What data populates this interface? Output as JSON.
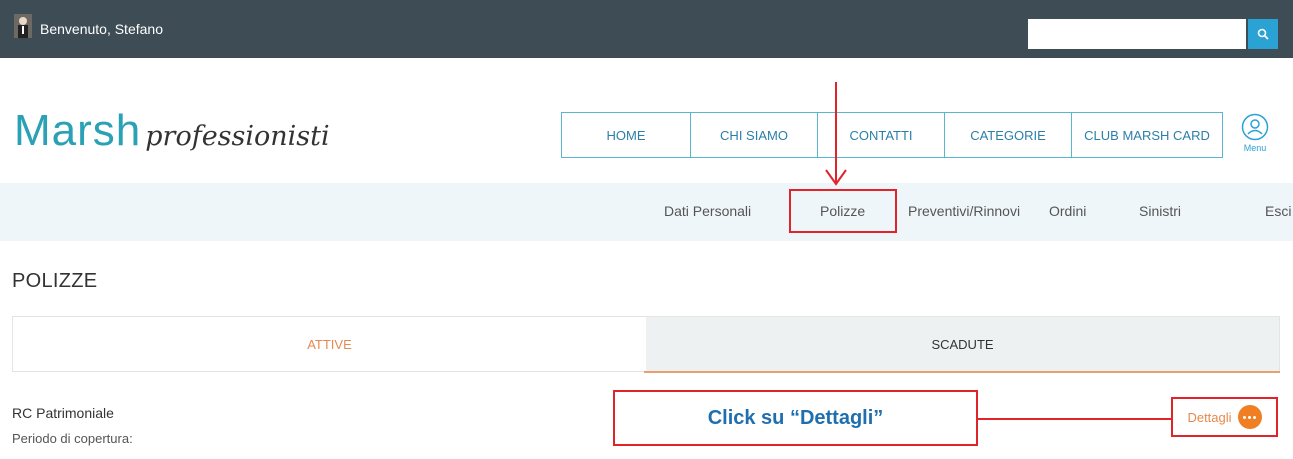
{
  "topbar": {
    "welcome": "Benvenuto, Stefano",
    "search_placeholder": "",
    "search_icon": "search-icon"
  },
  "logo": {
    "main": "Marsh",
    "sub": "professionisti"
  },
  "main_nav": [
    {
      "label": "HOME"
    },
    {
      "label": "CHI SIAMO"
    },
    {
      "label": "CONTATTI"
    },
    {
      "label": "CATEGORIE"
    },
    {
      "label": "CLUB MARSH CARD"
    }
  ],
  "menu": {
    "label": "Menu",
    "icon": "user-icon"
  },
  "subnav": [
    {
      "label": "Dati Personali"
    },
    {
      "label": "Polizze"
    },
    {
      "label": "Preventivi/Rinnovi"
    },
    {
      "label": "Ordini"
    },
    {
      "label": "Sinistri"
    },
    {
      "label": "Esci"
    }
  ],
  "page": {
    "title": "POLIZZE"
  },
  "tabs": [
    {
      "label": "ATTIVE",
      "active": true
    },
    {
      "label": "SCADUTE",
      "active": false
    }
  ],
  "policy": {
    "title": "RC Patrimoniale",
    "period_label": "Periodo di copertura:",
    "details_label": "Dettagli",
    "details_icon": "more-dots-icon"
  },
  "annotation": {
    "callout_text": "Click su “Dettagli”",
    "color": "#e0242a"
  },
  "colors": {
    "topbar": "#3d4c55",
    "accent_blue": "#2aa2d4",
    "accent_orange": "#f07e22",
    "logo_teal": "#2aa1b4"
  }
}
